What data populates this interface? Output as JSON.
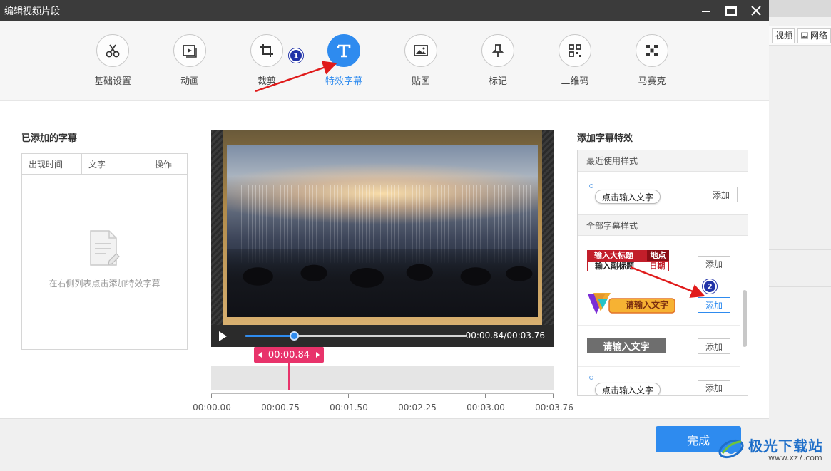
{
  "window": {
    "title": "编辑视频片段"
  },
  "background_app": {
    "btn1": "视频",
    "btn2": "网络"
  },
  "toolbar": {
    "tools": [
      {
        "label": "基础设置",
        "icon": "scissors-icon"
      },
      {
        "label": "动画",
        "icon": "play-frame-icon"
      },
      {
        "label": "裁剪",
        "icon": "crop-icon"
      },
      {
        "label": "特效字幕",
        "icon": "text-t-icon",
        "active": true
      },
      {
        "label": "贴图",
        "icon": "image-icon"
      },
      {
        "label": "标记",
        "icon": "pin-icon"
      },
      {
        "label": "二维码",
        "icon": "qrcode-icon"
      },
      {
        "label": "马赛克",
        "icon": "mosaic-icon"
      }
    ]
  },
  "left_panel": {
    "title": "已添加的字幕",
    "columns": [
      "出现时间",
      "文字",
      "操作"
    ],
    "empty_text": "在右侧列表点击添加特效字幕"
  },
  "player": {
    "time": "00:00.84/00:03.76",
    "progress": 0.22
  },
  "timeline": {
    "marker": "00:00.84",
    "ticks": [
      "00:00.00",
      "00:00.75",
      "00:01.50",
      "00:02.25",
      "00:03.00",
      "00:03.76"
    ]
  },
  "right_panel": {
    "title": "添加字幕特效",
    "recent_header": "最近使用样式",
    "all_header": "全部字幕样式",
    "add_label": "添加",
    "recent_style_text": "点击输入文字",
    "style1": {
      "title": "输入大标题",
      "subtitle": "输入副标题",
      "place": "地点",
      "date": "日期"
    },
    "style2_text": "请输入文字",
    "style3_text": "请输入文字",
    "style4_text": "点击输入文字"
  },
  "footer": {
    "done_label": "完成"
  },
  "annotations": {
    "badge1": "1",
    "badge2": "2"
  },
  "watermark": {
    "text": "极光下载站",
    "url": "www.xz7.com"
  },
  "colors": {
    "accent": "#2e8bef",
    "marker": "#e8336b",
    "titlebar": "#3b3b3b",
    "arrow": "#e01b1b"
  }
}
